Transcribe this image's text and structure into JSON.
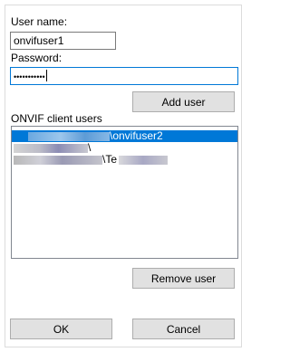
{
  "form": {
    "username_label": "User name:",
    "username_value": "onvifuser1",
    "password_label": "Password:",
    "password_value": "•••••••••••",
    "add_user_label": "Add user"
  },
  "users": {
    "section_label": "ONVIF client users",
    "items": [
      {
        "text": "\\onvifuser2",
        "selected": true
      },
      {
        "text": "\\",
        "selected": false
      },
      {
        "text": "\\Te",
        "selected": false
      }
    ],
    "remove_label": "Remove user"
  },
  "footer": {
    "ok_label": "OK",
    "cancel_label": "Cancel"
  },
  "colors": {
    "selection": "#0078d7",
    "button_face": "#e1e1e1",
    "focus_border": "#0078d7"
  }
}
